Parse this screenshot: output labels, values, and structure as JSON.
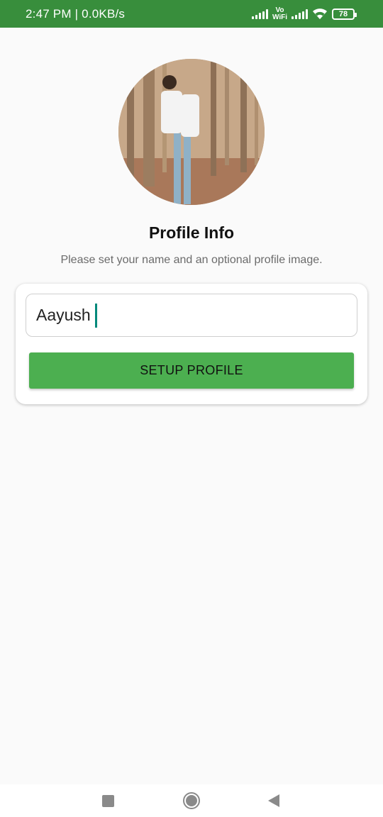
{
  "status_bar": {
    "time_speed": "2:47 PM | 0.0KB/s",
    "vo_label": "Vo",
    "wifi_label": "WiFi",
    "battery": "78",
    "icons": [
      "signal-icon",
      "signal-icon",
      "wifi-icon",
      "battery-icon"
    ]
  },
  "profile": {
    "avatar_icon": "profile-photo",
    "title": "Profile Info",
    "subtitle": "Please set your name and an optional profile image."
  },
  "form": {
    "name_value": "Aayush",
    "button_label": "SETUP PROFILE"
  },
  "nav_bar": {
    "icons": [
      "recents-square-icon",
      "home-circle-icon",
      "back-triangle-icon"
    ]
  },
  "colors": {
    "status_bar": "#388e3c",
    "button": "#4caf50",
    "caret": "#00897b",
    "background": "#fafafa"
  }
}
